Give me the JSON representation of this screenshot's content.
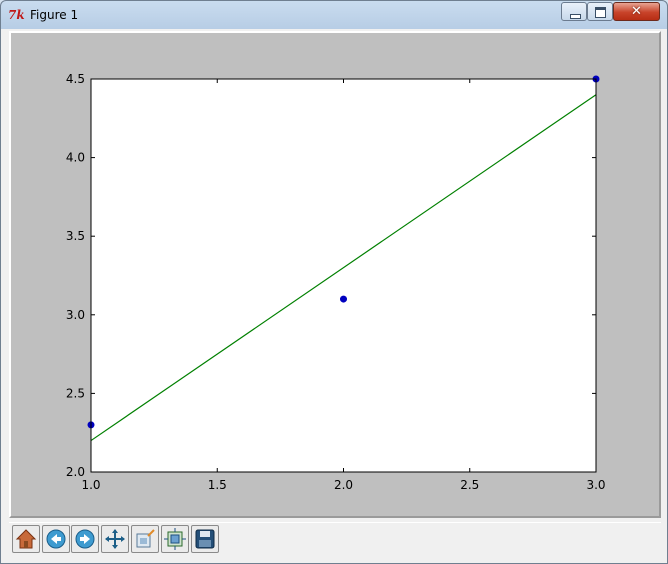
{
  "window": {
    "title": "Figure 1",
    "app_icon": "tk-icon",
    "controls": [
      "minimize-button",
      "maximize-button",
      "close-button"
    ]
  },
  "toolbar": {
    "buttons": [
      {
        "name": "home-button",
        "icon": "home-icon"
      },
      {
        "name": "back-button",
        "icon": "back-arrow-icon"
      },
      {
        "name": "forward-button",
        "icon": "forward-arrow-icon"
      },
      {
        "name": "pan-button",
        "icon": "move-arrows-icon"
      },
      {
        "name": "zoom-button",
        "icon": "zoom-rect-icon"
      },
      {
        "name": "subplots-button",
        "icon": "subplots-icon"
      },
      {
        "name": "save-button",
        "icon": "floppy-disk-icon"
      }
    ]
  },
  "chart_data": {
    "type": "scatter",
    "title": "",
    "xlabel": "",
    "ylabel": "",
    "xlim": [
      1.0,
      3.0
    ],
    "ylim": [
      2.0,
      4.5
    ],
    "x_ticks": [
      "1.0",
      "1.5",
      "2.0",
      "2.5",
      "3.0"
    ],
    "y_ticks": [
      "2.0",
      "2.5",
      "3.0",
      "3.5",
      "4.0",
      "4.5"
    ],
    "grid": false,
    "series": [
      {
        "kind": "points",
        "color": "#0000bf",
        "x": [
          1.0,
          2.0,
          3.0
        ],
        "y": [
          2.3,
          3.1,
          4.5
        ]
      },
      {
        "kind": "line",
        "color": "#008000",
        "x": [
          1.0,
          3.0
        ],
        "y": [
          2.2,
          4.4
        ]
      }
    ]
  }
}
